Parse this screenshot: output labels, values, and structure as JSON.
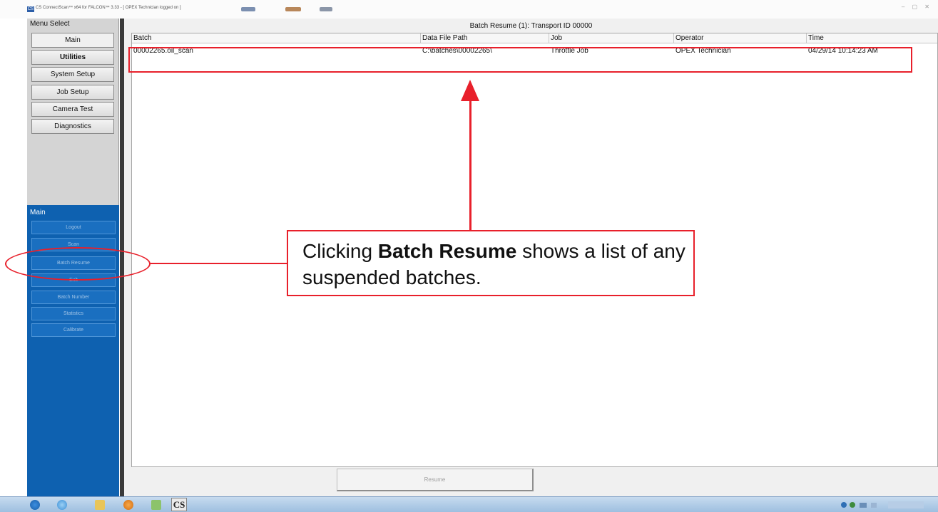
{
  "window": {
    "app_icon": "CS",
    "title": "CS ConnectScan™ x64 for FALCON™ 3.33 - [ OPEX Technician logged on ]",
    "controls": "‒ ▢ ✕"
  },
  "menu_select": {
    "label": "Menu Select",
    "items": [
      {
        "label": "Main",
        "active": true
      },
      {
        "label": "Utilities"
      },
      {
        "label": "System Setup"
      },
      {
        "label": "Job Setup"
      },
      {
        "label": "Camera Test"
      },
      {
        "label": "Diagnostics"
      }
    ]
  },
  "main_section": {
    "label": "Main",
    "buttons": [
      "Logout",
      "Scan",
      "Batch Resume",
      "Exit",
      "Batch Number",
      "Statistics",
      "Calibrate"
    ]
  },
  "table": {
    "title": "Batch Resume (1): Transport ID 00000",
    "columns": [
      "Batch",
      "Data File Path",
      "Job",
      "Operator",
      "Time"
    ],
    "rows": [
      {
        "batch": "00002265.oil_scan",
        "path": "C:\\batches\\00002265\\",
        "job": "Throttle Job",
        "operator": "OPEX Technician",
        "time": "04/29/14 10:14:23 AM"
      }
    ]
  },
  "resume_button": "Resume",
  "callout": {
    "prefix": "Clicking",
    "bold": "Batch Resume",
    "suffix": "shows a list of any suspended batches."
  },
  "taskbar": {
    "cs_icon": "CS"
  },
  "colors": {
    "annotation_red": "#e8202b",
    "panel_blue": "#0e61b0",
    "menu_gray": "#d4d4d4"
  }
}
